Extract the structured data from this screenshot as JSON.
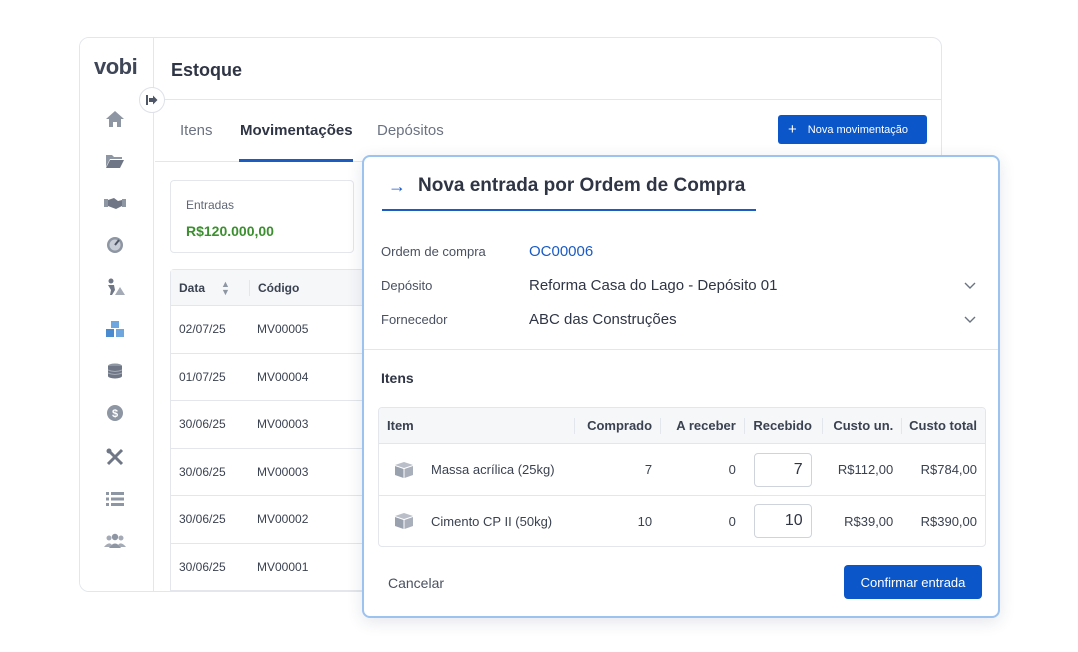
{
  "brand": {
    "logo": "vobi"
  },
  "page": {
    "title": "Estoque"
  },
  "tabs": [
    {
      "label": "Itens",
      "active": false
    },
    {
      "label": "Movimentações",
      "active": true
    },
    {
      "label": "Depósitos",
      "active": false
    }
  ],
  "toolbar": {
    "new_movement_label": "Nova movimentação"
  },
  "summary": {
    "label": "Entradas",
    "value": "R$120.000,00",
    "value_color": "#3b8f2e"
  },
  "movements_table": {
    "headers": {
      "date": "Data",
      "code": "Código"
    },
    "rows": [
      {
        "date": "02/07/25",
        "code": "MV00005"
      },
      {
        "date": "01/07/25",
        "code": "MV00004"
      },
      {
        "date": "30/06/25",
        "code": "MV00003"
      },
      {
        "date": "30/06/25",
        "code": "MV00003"
      },
      {
        "date": "30/06/25",
        "code": "MV00002"
      },
      {
        "date": "30/06/25",
        "code": "MV00001"
      }
    ]
  },
  "sidebar": {
    "icons": [
      "home-icon",
      "folder-icon",
      "handshake-icon",
      "dashboard-icon",
      "worker-icon",
      "boxes-icon",
      "coins-icon",
      "dollar-icon",
      "tools-icon",
      "list-icon",
      "team-icon"
    ]
  },
  "modal": {
    "title": "Nova entrada por Ordem de Compra",
    "fields": {
      "order_label": "Ordem de compra",
      "order_value": "OC00006",
      "deposit_label": "Depósito",
      "deposit_value": "Reforma Casa do Lago - Depósito 01",
      "supplier_label": "Fornecedor",
      "supplier_value": "ABC das Construções"
    },
    "items_title": "Itens",
    "items_headers": {
      "item": "Item",
      "bought": "Comprado",
      "to_receive": "A receber",
      "received": "Recebido",
      "unit_cost": "Custo un.",
      "total_cost": "Custo total"
    },
    "items": [
      {
        "name": "Massa acrílica (25kg)",
        "bought": "7",
        "to_receive": "0",
        "received": "7",
        "unit_cost": "R$112,00",
        "total_cost": "R$784,00"
      },
      {
        "name": "Cimento CP II (50kg)",
        "bought": "10",
        "to_receive": "0",
        "received": "10",
        "unit_cost": "R$39,00",
        "total_cost": "R$390,00"
      }
    ],
    "cancel_label": "Cancelar",
    "confirm_label": "Confirmar entrada"
  },
  "colors": {
    "primary": "#0b56c9",
    "modal_border": "#9cc2ef",
    "positive": "#3b8f2e"
  }
}
